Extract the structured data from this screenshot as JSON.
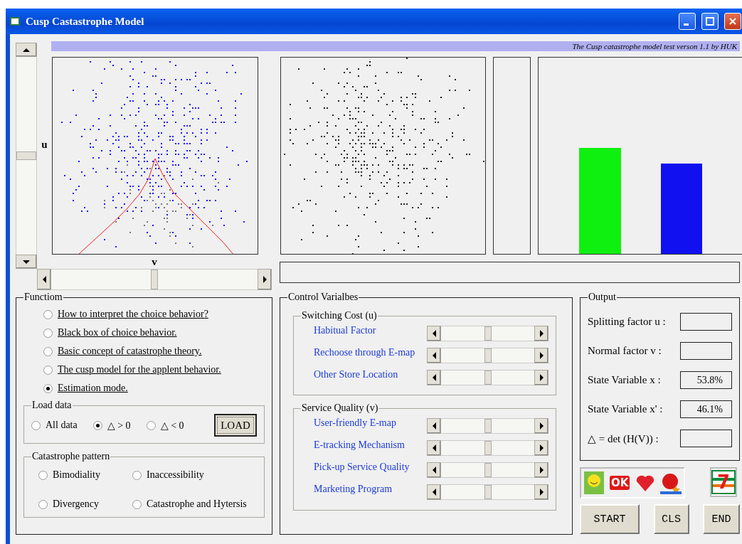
{
  "window": {
    "title": "Cusp Castastrophe Model"
  },
  "banner": "The Cusp catastrophe model test verson 1.1 by HUK",
  "plot": {
    "y_label": "u",
    "x_label": "v",
    "u_slider": {
      "level": 0.5
    },
    "v_slider": {
      "level": 0.5
    }
  },
  "function_group": {
    "title": "Functiom",
    "options": [
      {
        "label": "How to interpret the choice behavior?",
        "selected": false
      },
      {
        "label": "Black box of choice behavior.",
        "selected": false
      },
      {
        "label": "Basic concept of catastrophe theory.",
        "selected": false
      },
      {
        "label": "The cusp model for the applent behavior.",
        "selected": false
      },
      {
        "label": "Estimation mode.",
        "selected": true
      }
    ]
  },
  "load_data": {
    "title": "Load data",
    "options": [
      {
        "label": "All data",
        "selected": false
      },
      {
        "label": "△ > 0",
        "selected": true
      },
      {
        "label": "△ < 0",
        "selected": false
      }
    ],
    "button": "LOAD"
  },
  "catastrophe_pattern": {
    "title": "Catastrophe pattern",
    "options": [
      {
        "label": "Bimodiality",
        "selected": false
      },
      {
        "label": "Inaccessibility",
        "selected": false
      },
      {
        "label": "Divergency",
        "selected": false
      },
      {
        "label": "Catastrophe and Hytersis",
        "selected": false
      }
    ]
  },
  "control_variables": {
    "title": "Control Varialbes",
    "groups": [
      {
        "title": "Switching Cost (u)",
        "items": [
          {
            "label": "Habitual Factor",
            "level": 0.5
          },
          {
            "label": "Rechoose through E-map",
            "level": 0.5
          },
          {
            "label": "Other Store Location",
            "level": 0.5
          }
        ]
      },
      {
        "title": "Service Quality (v)",
        "items": [
          {
            "label": "User-friendly E-map",
            "level": 0.5
          },
          {
            "label": "E-tracking Mechanism",
            "level": 0.5
          },
          {
            "label": "Pick-up Service Quality",
            "level": 0.5
          },
          {
            "label": "Marketing Program",
            "level": 0.5
          }
        ]
      }
    ]
  },
  "output": {
    "title": "Output",
    "fields": [
      {
        "label": "Splitting factor u :"
      },
      {
        "label": "Normal factor v :"
      },
      {
        "label": "State Variable x :",
        "value": "53.8%"
      },
      {
        "label": "State Variable x' :",
        "value": "46.1%"
      },
      {
        "label": "△ = det (H(V)) :"
      }
    ]
  },
  "store_logos": [
    {
      "kind": "smile"
    },
    {
      "kind": "ok",
      "text": "OK"
    },
    {
      "kind": "heart"
    },
    {
      "kind": "ball"
    }
  ],
  "seven_logo": {
    "text": "7"
  },
  "buttons": [
    "START",
    "CLS",
    "END"
  ]
}
